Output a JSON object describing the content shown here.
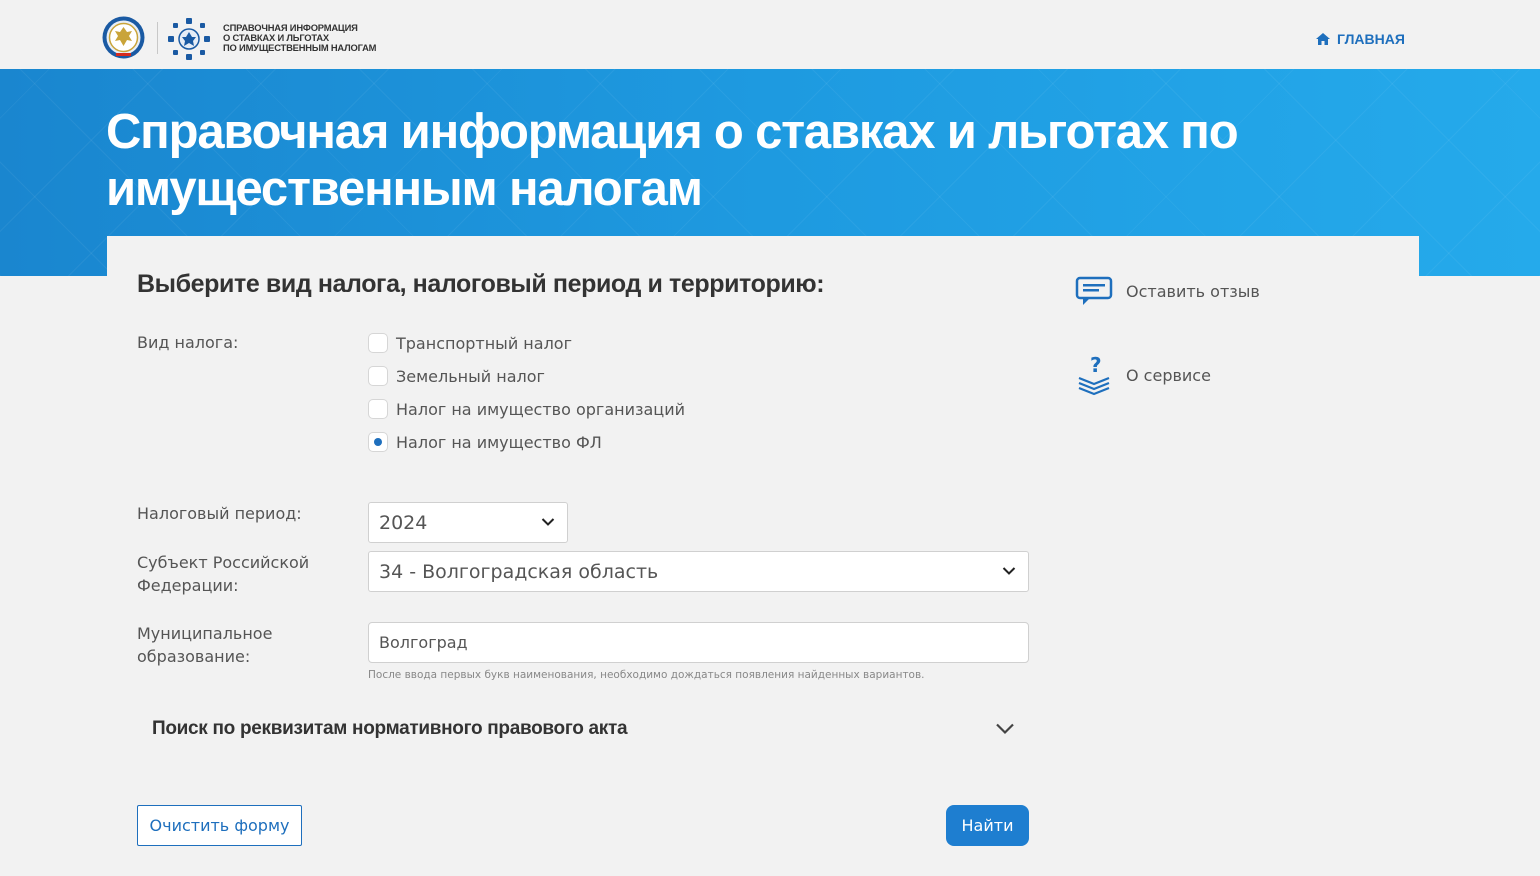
{
  "header": {
    "logo_text": [
      "СПРАВОЧНАЯ ИНФОРМАЦИЯ",
      "О СТАВКАХ И ЛЬГОТАХ",
      "ПО ИМУЩЕСТВЕННЫМ НАЛОГАМ"
    ],
    "nav_home": "ГЛАВНАЯ"
  },
  "banner": {
    "title": "Справочная информация о ставках и льготах по имущественным налогам"
  },
  "form": {
    "section_title": "Выберите вид налога, налоговый период и территорию:",
    "tax_type_label": "Вид налога:",
    "tax_types": [
      {
        "label": "Транспортный налог",
        "checked": false
      },
      {
        "label": "Земельный налог",
        "checked": false
      },
      {
        "label": "Налог на имущество организаций",
        "checked": false
      },
      {
        "label": "Налог на имущество ФЛ",
        "checked": true
      }
    ],
    "period_label": "Налоговый период:",
    "period_value": "2024",
    "region_label": "Субъект Российской Федерации:",
    "region_value": "34 - Волгоградская область",
    "municipality_label": "Муниципальное образование:",
    "municipality_value": "Волгоград",
    "municipality_hint": "После ввода первых букв наименования, необходимо дождаться появления найденных вариантов.",
    "accordion_title": "Поиск по реквизитам нормативного правового акта",
    "clear_button": "Очистить форму",
    "find_button": "Найти"
  },
  "side": {
    "feedback": "Оставить отзыв",
    "about": "О сервисе"
  },
  "colors": {
    "accent": "#1e6fbd",
    "banner": "#1e9ae0",
    "button": "#1e7ed0"
  }
}
